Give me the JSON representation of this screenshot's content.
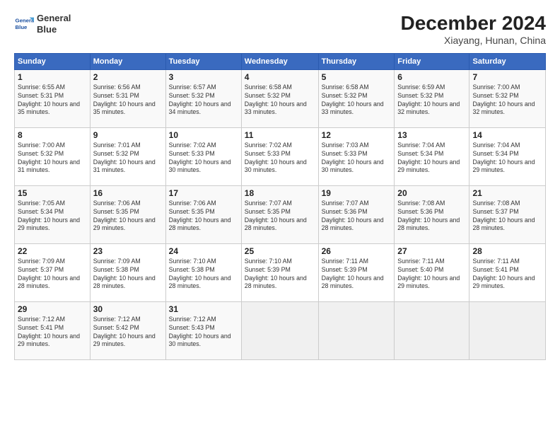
{
  "header": {
    "logo_line1": "General",
    "logo_line2": "Blue",
    "month_title": "December 2024",
    "location": "Xiayang, Hunan, China"
  },
  "weekdays": [
    "Sunday",
    "Monday",
    "Tuesday",
    "Wednesday",
    "Thursday",
    "Friday",
    "Saturday"
  ],
  "weeks": [
    [
      {
        "day": "1",
        "sunrise": "Sunrise: 6:55 AM",
        "sunset": "Sunset: 5:31 PM",
        "daylight": "Daylight: 10 hours and 35 minutes."
      },
      {
        "day": "2",
        "sunrise": "Sunrise: 6:56 AM",
        "sunset": "Sunset: 5:31 PM",
        "daylight": "Daylight: 10 hours and 35 minutes."
      },
      {
        "day": "3",
        "sunrise": "Sunrise: 6:57 AM",
        "sunset": "Sunset: 5:32 PM",
        "daylight": "Daylight: 10 hours and 34 minutes."
      },
      {
        "day": "4",
        "sunrise": "Sunrise: 6:58 AM",
        "sunset": "Sunset: 5:32 PM",
        "daylight": "Daylight: 10 hours and 33 minutes."
      },
      {
        "day": "5",
        "sunrise": "Sunrise: 6:58 AM",
        "sunset": "Sunset: 5:32 PM",
        "daylight": "Daylight: 10 hours and 33 minutes."
      },
      {
        "day": "6",
        "sunrise": "Sunrise: 6:59 AM",
        "sunset": "Sunset: 5:32 PM",
        "daylight": "Daylight: 10 hours and 32 minutes."
      },
      {
        "day": "7",
        "sunrise": "Sunrise: 7:00 AM",
        "sunset": "Sunset: 5:32 PM",
        "daylight": "Daylight: 10 hours and 32 minutes."
      }
    ],
    [
      {
        "day": "8",
        "sunrise": "Sunrise: 7:00 AM",
        "sunset": "Sunset: 5:32 PM",
        "daylight": "Daylight: 10 hours and 31 minutes."
      },
      {
        "day": "9",
        "sunrise": "Sunrise: 7:01 AM",
        "sunset": "Sunset: 5:32 PM",
        "daylight": "Daylight: 10 hours and 31 minutes."
      },
      {
        "day": "10",
        "sunrise": "Sunrise: 7:02 AM",
        "sunset": "Sunset: 5:33 PM",
        "daylight": "Daylight: 10 hours and 30 minutes."
      },
      {
        "day": "11",
        "sunrise": "Sunrise: 7:02 AM",
        "sunset": "Sunset: 5:33 PM",
        "daylight": "Daylight: 10 hours and 30 minutes."
      },
      {
        "day": "12",
        "sunrise": "Sunrise: 7:03 AM",
        "sunset": "Sunset: 5:33 PM",
        "daylight": "Daylight: 10 hours and 30 minutes."
      },
      {
        "day": "13",
        "sunrise": "Sunrise: 7:04 AM",
        "sunset": "Sunset: 5:34 PM",
        "daylight": "Daylight: 10 hours and 29 minutes."
      },
      {
        "day": "14",
        "sunrise": "Sunrise: 7:04 AM",
        "sunset": "Sunset: 5:34 PM",
        "daylight": "Daylight: 10 hours and 29 minutes."
      }
    ],
    [
      {
        "day": "15",
        "sunrise": "Sunrise: 7:05 AM",
        "sunset": "Sunset: 5:34 PM",
        "daylight": "Daylight: 10 hours and 29 minutes."
      },
      {
        "day": "16",
        "sunrise": "Sunrise: 7:06 AM",
        "sunset": "Sunset: 5:35 PM",
        "daylight": "Daylight: 10 hours and 29 minutes."
      },
      {
        "day": "17",
        "sunrise": "Sunrise: 7:06 AM",
        "sunset": "Sunset: 5:35 PM",
        "daylight": "Daylight: 10 hours and 28 minutes."
      },
      {
        "day": "18",
        "sunrise": "Sunrise: 7:07 AM",
        "sunset": "Sunset: 5:35 PM",
        "daylight": "Daylight: 10 hours and 28 minutes."
      },
      {
        "day": "19",
        "sunrise": "Sunrise: 7:07 AM",
        "sunset": "Sunset: 5:36 PM",
        "daylight": "Daylight: 10 hours and 28 minutes."
      },
      {
        "day": "20",
        "sunrise": "Sunrise: 7:08 AM",
        "sunset": "Sunset: 5:36 PM",
        "daylight": "Daylight: 10 hours and 28 minutes."
      },
      {
        "day": "21",
        "sunrise": "Sunrise: 7:08 AM",
        "sunset": "Sunset: 5:37 PM",
        "daylight": "Daylight: 10 hours and 28 minutes."
      }
    ],
    [
      {
        "day": "22",
        "sunrise": "Sunrise: 7:09 AM",
        "sunset": "Sunset: 5:37 PM",
        "daylight": "Daylight: 10 hours and 28 minutes."
      },
      {
        "day": "23",
        "sunrise": "Sunrise: 7:09 AM",
        "sunset": "Sunset: 5:38 PM",
        "daylight": "Daylight: 10 hours and 28 minutes."
      },
      {
        "day": "24",
        "sunrise": "Sunrise: 7:10 AM",
        "sunset": "Sunset: 5:38 PM",
        "daylight": "Daylight: 10 hours and 28 minutes."
      },
      {
        "day": "25",
        "sunrise": "Sunrise: 7:10 AM",
        "sunset": "Sunset: 5:39 PM",
        "daylight": "Daylight: 10 hours and 28 minutes."
      },
      {
        "day": "26",
        "sunrise": "Sunrise: 7:11 AM",
        "sunset": "Sunset: 5:39 PM",
        "daylight": "Daylight: 10 hours and 28 minutes."
      },
      {
        "day": "27",
        "sunrise": "Sunrise: 7:11 AM",
        "sunset": "Sunset: 5:40 PM",
        "daylight": "Daylight: 10 hours and 29 minutes."
      },
      {
        "day": "28",
        "sunrise": "Sunrise: 7:11 AM",
        "sunset": "Sunset: 5:41 PM",
        "daylight": "Daylight: 10 hours and 29 minutes."
      }
    ],
    [
      {
        "day": "29",
        "sunrise": "Sunrise: 7:12 AM",
        "sunset": "Sunset: 5:41 PM",
        "daylight": "Daylight: 10 hours and 29 minutes."
      },
      {
        "day": "30",
        "sunrise": "Sunrise: 7:12 AM",
        "sunset": "Sunset: 5:42 PM",
        "daylight": "Daylight: 10 hours and 29 minutes."
      },
      {
        "day": "31",
        "sunrise": "Sunrise: 7:12 AM",
        "sunset": "Sunset: 5:43 PM",
        "daylight": "Daylight: 10 hours and 30 minutes."
      },
      null,
      null,
      null,
      null
    ]
  ]
}
